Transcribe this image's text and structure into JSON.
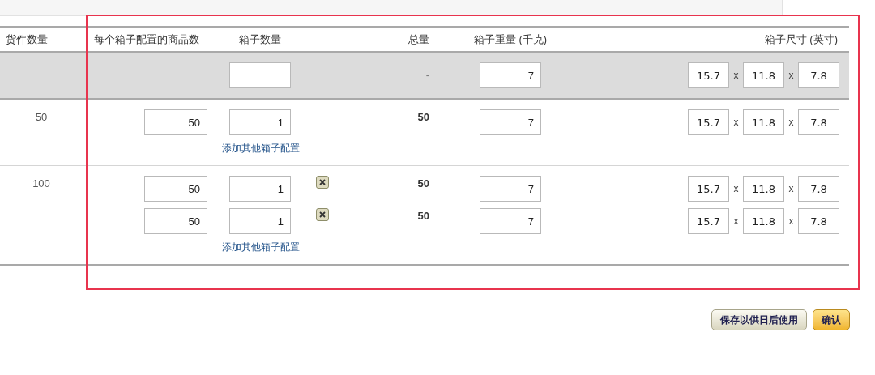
{
  "table": {
    "columns": [
      "货件数量",
      "每个箱子配置的商品数",
      "箱子数量",
      "总量",
      "箱子重量 (千克)",
      "箱子尺寸 (英寸)"
    ],
    "default_row": {
      "total": "-",
      "weight": "7",
      "dims": [
        {
          "value": "15.7",
          "sep": "x"
        },
        {
          "value": "11.8",
          "sep": "x"
        },
        {
          "value": "7.8"
        }
      ]
    },
    "rows": [
      {
        "quantity": "50",
        "configs": [
          {
            "units_per_box": "50",
            "box_count": "1",
            "removable": false,
            "total": "50",
            "weight": "7",
            "dims": [
              {
                "value": "15.7",
                "sep": "x"
              },
              {
                "value": "11.8",
                "sep": "x"
              },
              {
                "value": "7.8"
              }
            ]
          }
        ],
        "add_link": "添加其他箱子配置"
      },
      {
        "quantity": "100",
        "configs": [
          {
            "units_per_box": "50",
            "box_count": "1",
            "removable": true,
            "total": "50",
            "weight": "7",
            "dims": [
              {
                "value": "15.7",
                "sep": "x"
              },
              {
                "value": "11.8",
                "sep": "x"
              },
              {
                "value": "7.8"
              }
            ]
          },
          {
            "units_per_box": "50",
            "box_count": "1",
            "removable": true,
            "total": "50",
            "weight": "7",
            "dims": [
              {
                "value": "15.7",
                "sep": "x"
              },
              {
                "value": "11.8",
                "sep": "x"
              },
              {
                "value": "7.8"
              }
            ]
          }
        ],
        "add_link": "添加其他箱子配置"
      }
    ]
  },
  "buttons": [
    {
      "label": "保存以供日后使用",
      "kind": "secondary"
    },
    {
      "label": "确认",
      "kind": "primary"
    }
  ]
}
